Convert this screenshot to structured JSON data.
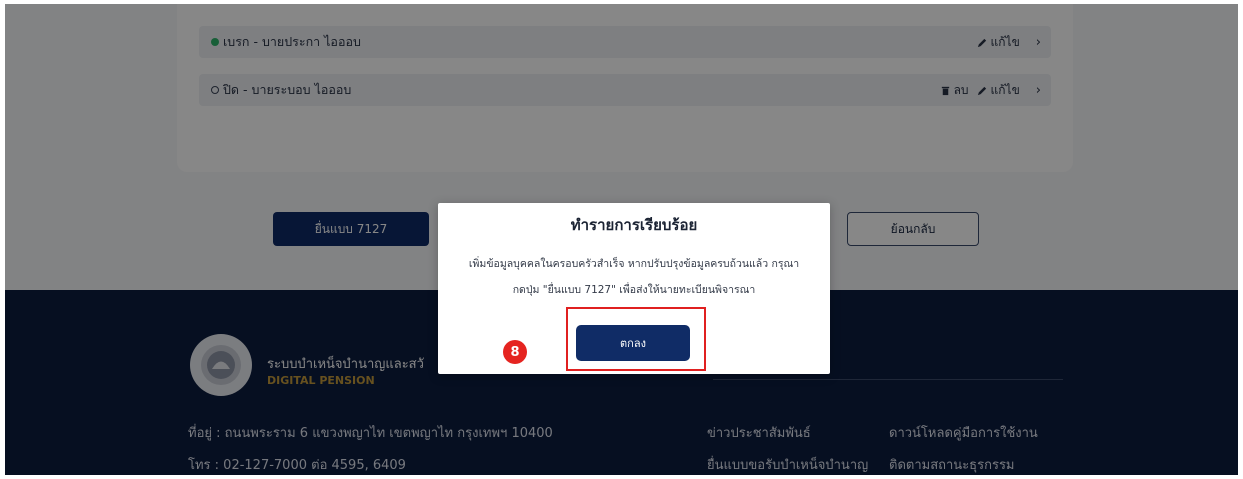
{
  "rows": [
    {
      "status": "complete",
      "label": "เบรก - บายประกา ไอออบ",
      "actions": [
        {
          "icon": "pencil-icon",
          "label": "แก้ไข"
        }
      ]
    },
    {
      "status": "incomplete",
      "label": "ปิด - บายระบอบ ไอออบ",
      "actions": [
        {
          "icon": "trash-icon",
          "label": "ลบ"
        },
        {
          "icon": "pencil-icon",
          "label": "แก้ไข"
        }
      ]
    }
  ],
  "actions": {
    "submit": "ยื่นแบบ 7127",
    "back": "ย้อนกลับ"
  },
  "footer": {
    "org_name": "ระบบบำเหน็จบำนาญและสวั",
    "org_sub": "DIGITAL PENSION",
    "address": "ที่อยู่ : ถนนพระราม 6 แขวงพญาไท เขตพญาไท กรุงเทพฯ 10400",
    "phone": "โทร : 02-127-7000 ต่อ 4595, 6409",
    "links": [
      "ข่าวประชาสัมพันธ์",
      "ดาวน์โหลดคู่มือการใช้งาน",
      "ยื่นแบบขอรับบำเหน็จบำนาญ",
      "ติดตามสถานะธุรกรรม"
    ]
  },
  "modal": {
    "title": "ทำรายการเรียบร้อย",
    "body_line1": "เพิ่มข้อมูลบุคคลในครอบครัวสำเร็จ หากปรับปรุงข้อมูลครบถ้วนแล้ว กรุณา",
    "body_line2": "กดปุ่ม \"ยื่นแบบ 7127\" เพื่อส่งให้นายทะเบียนพิจารณา",
    "ok_label": "ตกลง"
  },
  "annotation": {
    "step": "8"
  },
  "colors": {
    "primary": "#0f2b66",
    "footer_bg": "#0d1d3f",
    "highlight": "#e02020",
    "status_ok": "#2fb36b"
  }
}
